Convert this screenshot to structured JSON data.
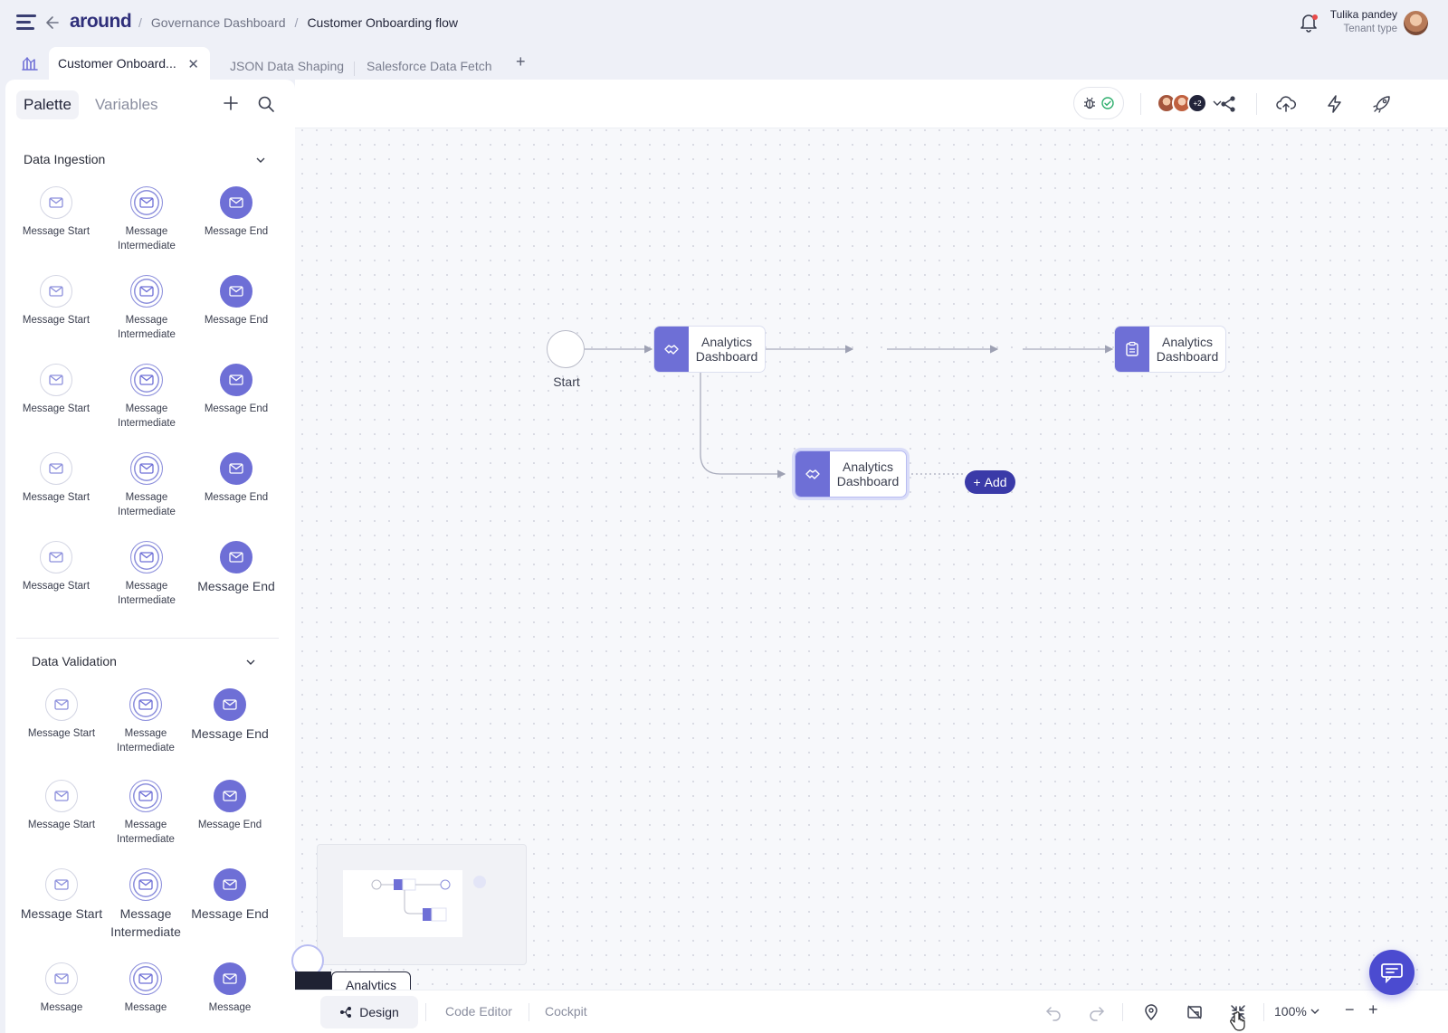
{
  "header": {
    "logo": "around",
    "breadcrumbs": [
      "Governance Dashboard",
      "Customer Onboarding flow"
    ],
    "user": {
      "name": "Tulika pandey",
      "role": "Tenant type"
    }
  },
  "tabs": [
    {
      "label": "Customer Onboard...",
      "active": true
    },
    {
      "label": "JSON Data Shaping",
      "active": false
    },
    {
      "label": "Salesforce Data Fetch",
      "active": false
    }
  ],
  "sidebar": {
    "tabs": [
      "Palette",
      "Variables"
    ],
    "sections": [
      {
        "title": "Data Ingestion",
        "rows": [
          [
            "Message Start",
            "Message Intermediate",
            "Message End"
          ],
          [
            "Message Start",
            "Message Intermediate",
            "Message End"
          ],
          [
            "Message Start",
            "Message Intermediate",
            "Message End"
          ],
          [
            "Message Start",
            "Message Intermediate",
            "Message End"
          ],
          [
            "Message Start",
            "Message Intermediate",
            "Message End"
          ]
        ]
      },
      {
        "title": "Data Validation",
        "rows": [
          [
            "Message Start",
            "Message Intermediate",
            "Message End"
          ],
          [
            "Message Start",
            "Message Intermediate",
            "Message End"
          ],
          [
            "Message Start",
            "Message Intermediate",
            "Message End"
          ],
          [
            "Message",
            "Message",
            "Message"
          ]
        ]
      }
    ]
  },
  "toolbar": {
    "more_collaborators": "+2",
    "icons": [
      "bug-icon",
      "check-circle-icon",
      "share-icon",
      "cloud-upload-icon",
      "lightning-icon",
      "rocket-icon"
    ]
  },
  "flow": {
    "start_label": "Start",
    "task1": "Analytics Dashboard",
    "task2": "Analytics Dashboard",
    "task3": "Analytics Dashboard",
    "add_label": "Add"
  },
  "minimap": {
    "label": "Analytics"
  },
  "bottombar": {
    "design": "Design",
    "code_editor": "Code Editor",
    "cockpit": "Cockpit",
    "zoom": "100%"
  },
  "colors": {
    "accent": "#6e6fd6",
    "brand": "#2f2f7a",
    "add_button": "#3a3aa8"
  }
}
